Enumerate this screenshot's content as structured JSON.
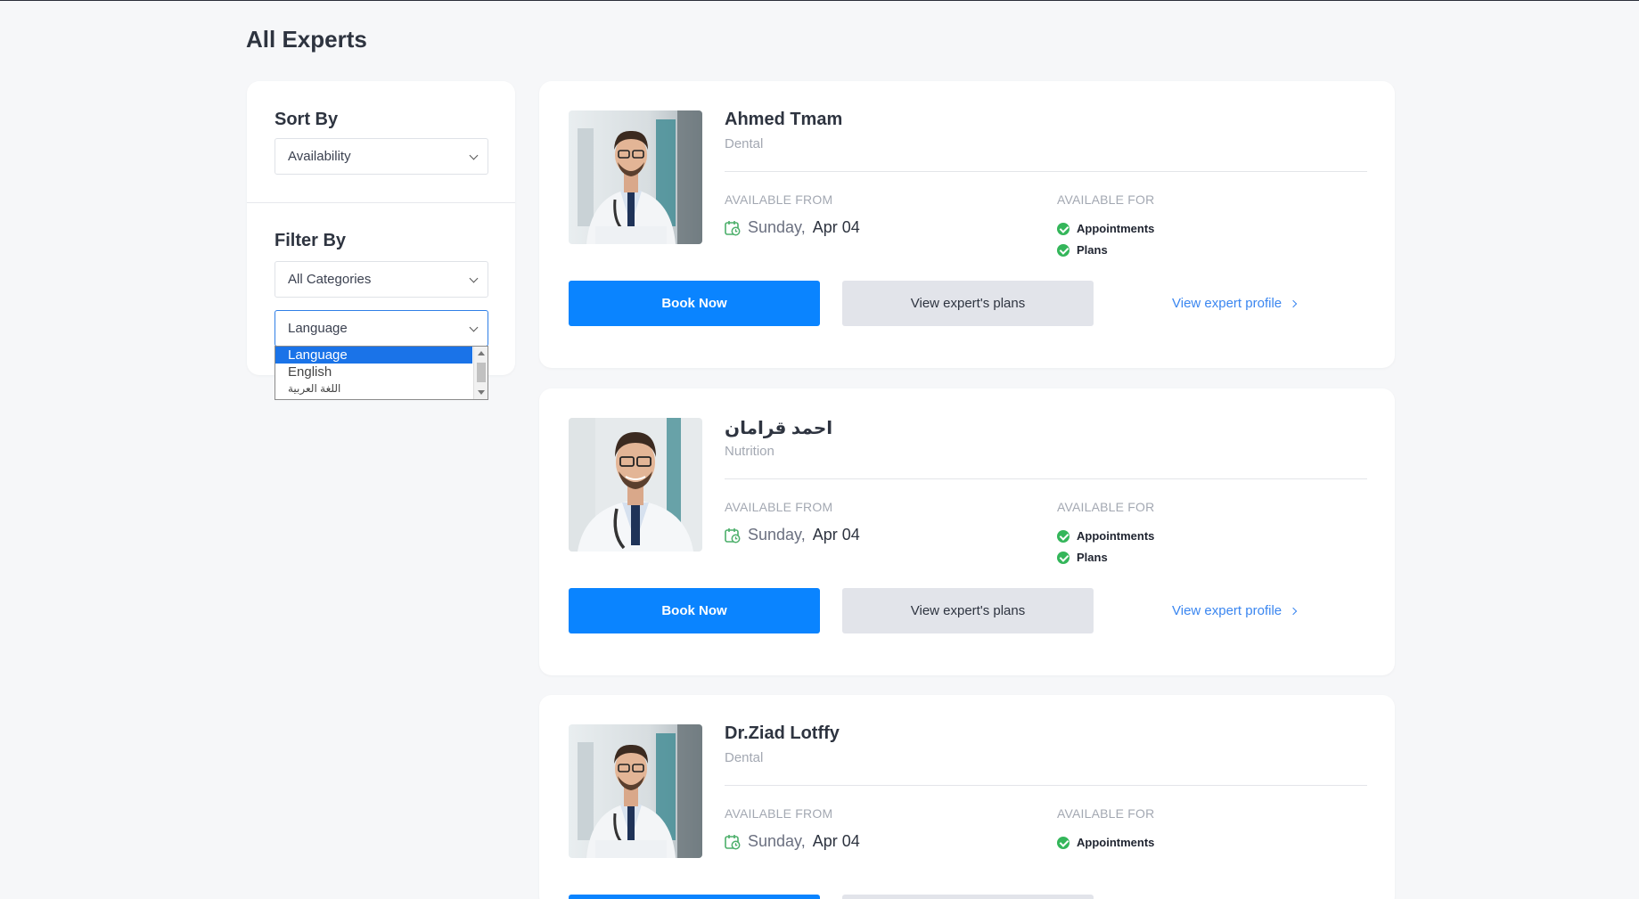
{
  "page": {
    "title": "All Experts"
  },
  "sidebar": {
    "sort_heading": "Sort By",
    "sort_value": "Availability",
    "filter_heading": "Filter By",
    "category_value": "All Categories",
    "language_value": "Language",
    "language_options": [
      "Language",
      "English",
      "اللغة العربية"
    ]
  },
  "labels": {
    "available_from": "AVAILABLE FROM",
    "available_for": "AVAILABLE FOR",
    "book_now": "Book Now",
    "view_plans": "View expert's plans",
    "view_profile": "View expert profile"
  },
  "experts": [
    {
      "name": "Ahmed Tmam",
      "category": "Dental",
      "day": "Sunday,",
      "date": "Apr 04",
      "features": [
        "Appointments",
        "Plans"
      ]
    },
    {
      "name": "احمد قرامان",
      "category": "Nutrition",
      "day": "Sunday,",
      "date": "Apr 04",
      "features": [
        "Appointments",
        "Plans"
      ]
    },
    {
      "name": "Dr.Ziad Lotffy",
      "category": "Dental",
      "day": "Sunday,",
      "date": "Apr 04",
      "features": [
        "Appointments"
      ]
    }
  ],
  "colors": {
    "primary": "#0a84ff",
    "check": "#34b65a",
    "link": "#3a86f0"
  }
}
